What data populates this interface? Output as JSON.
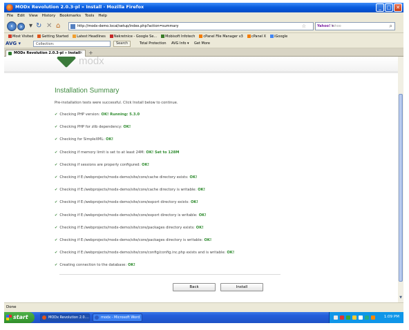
{
  "window": {
    "title": "MODx Revolution 2.0.3-pl » Install - Mozilla Firefox",
    "buttons": {
      "minimize": "_",
      "maximize": "□",
      "close": "✕"
    }
  },
  "menu": [
    "File",
    "Edit",
    "View",
    "History",
    "Bookmarks",
    "Tools",
    "Help"
  ],
  "navigation": {
    "url": "http://modx-demo.local/setup/index.php?action=summary",
    "search_engine": "Yahoo! ▾",
    "search_placeholder": "Yahoo"
  },
  "bookmarks": [
    {
      "label": "Most Visited",
      "icon": "#d23b2a"
    },
    {
      "label": "Getting Started",
      "icon": "#e0551b"
    },
    {
      "label": "Latest Headlines",
      "icon": "#f0a030"
    },
    {
      "label": "Nekretnice - Google Se...",
      "icon": "#c62828"
    },
    {
      "label": "Mobisoft Infotech",
      "icon": "#3a7d2a"
    },
    {
      "label": "cPanel File Manager v3",
      "icon": "#f57c00"
    },
    {
      "label": "cPanel X",
      "icon": "#f57c00"
    },
    {
      "label": "iGoogle",
      "icon": "#4285f4"
    }
  ],
  "toolbar2": {
    "logo": "AVG ▾",
    "search_text": "Collection:",
    "search_button": "Search",
    "items": [
      "Total Protection",
      "AVG Info ▾",
      "Get More"
    ]
  },
  "tab": {
    "label": "MODx Revolution 2.0.3-pl » Install"
  },
  "page": {
    "logo_text": "modx",
    "title": "Installation Summary",
    "intro": "Pre-installation tests were successful. Click Install below to continue.",
    "checks": [
      {
        "text": "Checking PHP version:",
        "result": "OK! Running: 5.3.0"
      },
      {
        "text": "Checking PHP for zlib dependency:",
        "result": "OK!"
      },
      {
        "text": "Checking for SimpleXML:",
        "result": "OK!"
      },
      {
        "text": "Checking if memory limit is set to at least 24M:",
        "result": "OK! Set to 128M"
      },
      {
        "text": "Checking if sessions are properly configured:",
        "result": "OK!"
      },
      {
        "text": "Checking if E:/webprojects/modx-demo/site/core/cache directory exists:",
        "result": "OK!"
      },
      {
        "text": "Checking if E:/webprojects/modx-demo/site/core/cache directory is writable:",
        "result": "OK!"
      },
      {
        "text": "Checking if E:/webprojects/modx-demo/site/core/export directory exists:",
        "result": "OK!"
      },
      {
        "text": "Checking if E:/webprojects/modx-demo/site/core/export directory is writable:",
        "result": "OK!"
      },
      {
        "text": "Checking if E:/webprojects/modx-demo/site/core/packages directory exists:",
        "result": "OK!"
      },
      {
        "text": "Checking if E:/webprojects/modx-demo/site/core/packages directory is writable:",
        "result": "OK!"
      },
      {
        "text": "Checking if E:/webprojects/modx-demo/site/core/config/config.inc.php exists and is writable:",
        "result": "OK!"
      },
      {
        "text": "Creating connection to the database:",
        "result": "OK!"
      }
    ],
    "back_label": "Back",
    "install_label": "Install"
  },
  "status": {
    "text": "Done"
  },
  "taskbar": {
    "start_label": "start",
    "tasks": [
      {
        "label": "MODx Revolution 2.0....",
        "icon": "#e0551b"
      },
      {
        "label": "modx - Microsoft Word",
        "icon": "#2b5cc5"
      }
    ],
    "clock": "1:09 PM"
  }
}
